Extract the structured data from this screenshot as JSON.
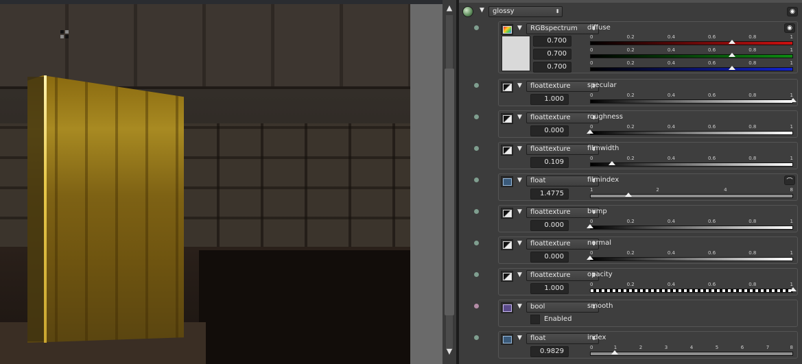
{
  "material": {
    "type": "glossy"
  },
  "params": [
    {
      "name": "diffuse",
      "type": "RGBspectrum",
      "values": [
        "0.700",
        "0.700",
        "0.700"
      ],
      "ticks": [
        "0",
        "0.2",
        "0.4",
        "0.6",
        "0.8",
        "1"
      ],
      "levels": [
        0.7,
        0.7,
        0.7
      ],
      "bar_colors": [
        "#cc1010",
        "#0d8a12",
        "#1222cc"
      ],
      "swatch": "#d9d9d9"
    },
    {
      "name": "specular",
      "type": "floattexture",
      "value": "1.000",
      "ticks": [
        "0",
        "0.2",
        "0.4",
        "0.6",
        "0.8",
        "1"
      ],
      "level": 1.0,
      "bar": "white-gradient"
    },
    {
      "name": "roughness",
      "type": "floattexture",
      "value": "0.000",
      "ticks": [
        "0",
        "0.2",
        "0.4",
        "0.6",
        "0.8",
        "1"
      ],
      "level": 0.0,
      "bar": "white-gradient"
    },
    {
      "name": "filmwidth",
      "type": "floattexture",
      "value": "0.109",
      "ticks": [
        "0",
        "0.2",
        "0.4",
        "0.6",
        "0.8",
        "1"
      ],
      "level": 0.109,
      "bar": "white-gradient"
    },
    {
      "name": "filmindex",
      "type": "float",
      "value": "1.4775",
      "ticks": [
        "1",
        "2",
        "4",
        "8"
      ],
      "level": 0.19,
      "bar": "gray"
    },
    {
      "name": "bump",
      "type": "floattexture",
      "value": "0.000",
      "ticks": [
        "0",
        "0.2",
        "0.4",
        "0.6",
        "0.8",
        "1"
      ],
      "level": 0.0,
      "bar": "white-gradient"
    },
    {
      "name": "normal",
      "type": "floattexture",
      "value": "0.000",
      "ticks": [
        "0",
        "0.2",
        "0.4",
        "0.6",
        "0.8",
        "1"
      ],
      "level": 0.0,
      "bar": "white-gradient"
    },
    {
      "name": "opacity",
      "type": "floattexture",
      "value": "1.000",
      "ticks": [
        "0",
        "0.2",
        "0.4",
        "0.6",
        "0.8",
        "1"
      ],
      "level": 1.0,
      "bar": "checker"
    },
    {
      "name": "smooth",
      "type": "bool",
      "checkbox_label": "Enabled",
      "checked": false
    },
    {
      "name": "index",
      "type": "float",
      "value": "0.9829",
      "ticks": [
        "0",
        "1",
        "2",
        "3",
        "4",
        "5",
        "6",
        "7",
        "8"
      ],
      "level": 0.1229,
      "bar": "gray"
    }
  ],
  "icons": {
    "eye": "eye-icon",
    "curve": "curve-icon",
    "updown": "updown-arrows-icon",
    "expand": "triangle-down-icon"
  },
  "scroll": {
    "up": "▲",
    "down": "▼"
  }
}
